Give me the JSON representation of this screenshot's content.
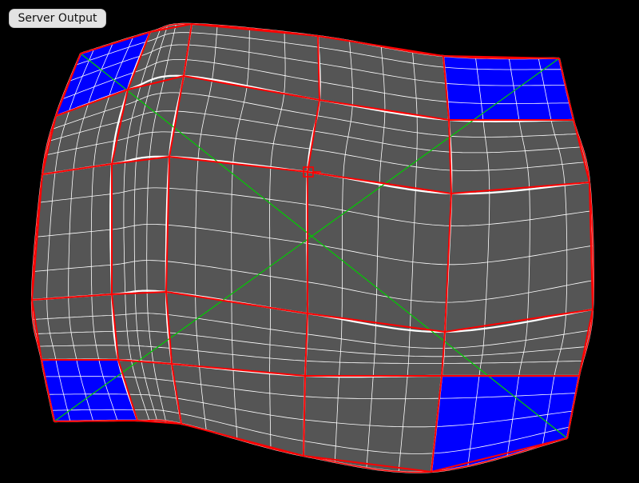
{
  "toolbar": {
    "server_output_label": "Server Output"
  },
  "warp": {
    "cols": 5,
    "rows": 5,
    "sub_divisions": 4,
    "colors": {
      "background": "#000000",
      "grid_fill": "#555555",
      "corner_fill": "#0000ff",
      "fine_lines": "#ffffff",
      "bold_lines": "#ffffff",
      "control_lines": "#ff0000",
      "diagonals": "#00cc00",
      "handle": "#ff0000"
    },
    "selected_handle": {
      "row": 1,
      "col": 2,
      "icon": "square-handle-icon"
    }
  }
}
